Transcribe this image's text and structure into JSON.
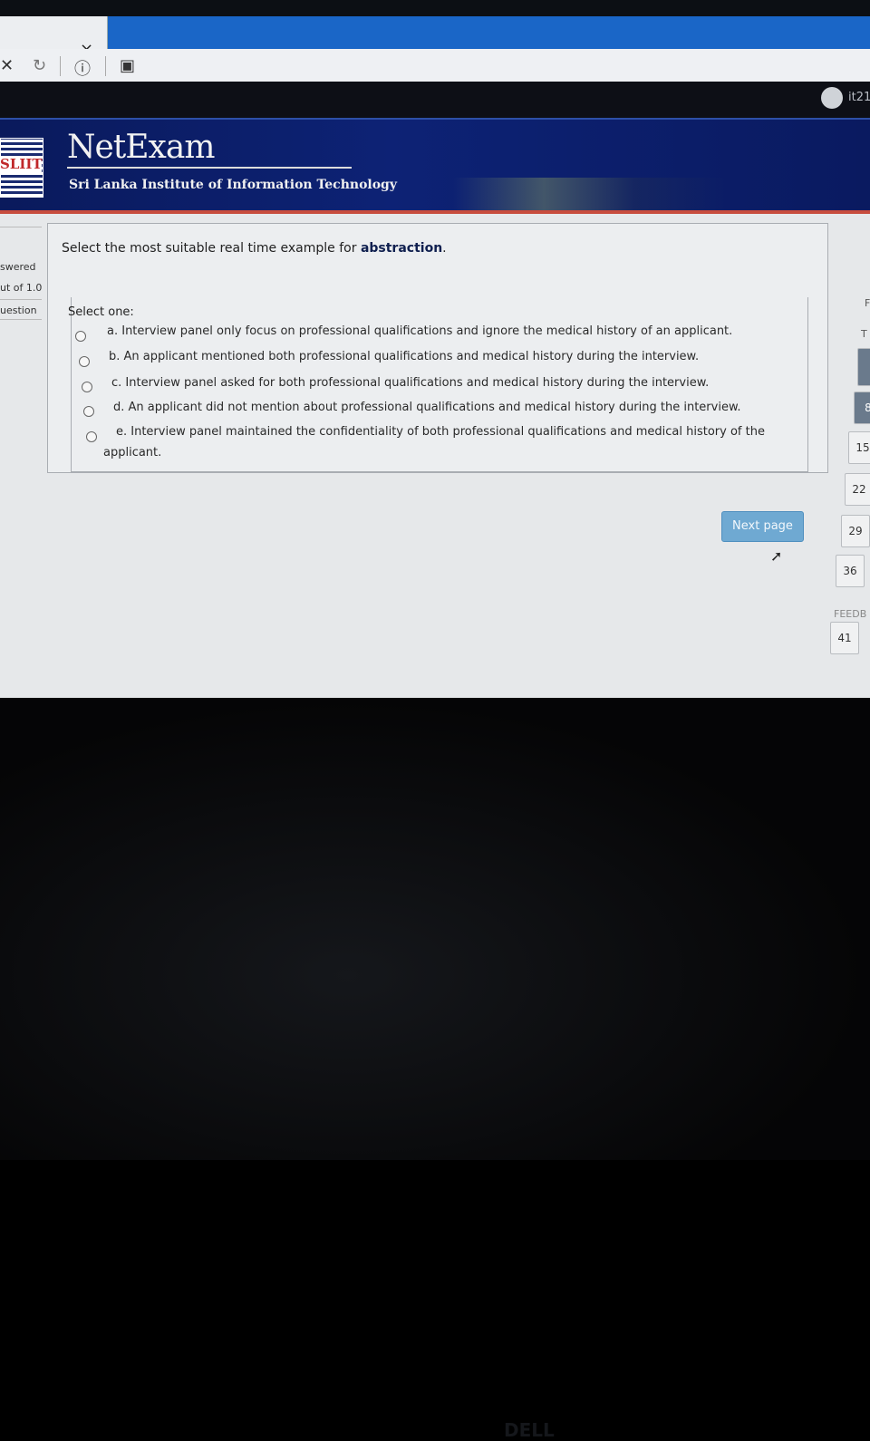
{
  "browser": {
    "tab_close_glyph": "×",
    "nav_icons": [
      "close-icon",
      "reload-icon",
      "info-icon",
      "page-icon"
    ],
    "user_name": "it21"
  },
  "header": {
    "logo_text": "SLIIT",
    "title": "NetExam",
    "subtitle": "Sri Lanka Institute of Information Technology"
  },
  "left_info": {
    "answered": "swered",
    "marks": "ut of 1.0",
    "question": "uestion"
  },
  "question": {
    "prefix": "Select the most suitable real time example for ",
    "highlight": "abstraction",
    "suffix": ".",
    "select_label": "Select one:",
    "options": [
      {
        "text": "a. Interview panel only focus on professional qualifications and ignore the medical history of an applicant."
      },
      {
        "text": "b. An applicant mentioned both professional qualifications and medical history during the interview."
      },
      {
        "text": "c. Interview panel asked for both professional qualifications and medical history during the interview."
      },
      {
        "text": "d. An applicant did not mention about professional qualifications and medical history during the interview."
      },
      {
        "text": "e. Interview panel maintained the confidentiality of both professional qualifications and medical history of the",
        "text2": "applicant."
      }
    ]
  },
  "buttons": {
    "next_page": "Next page"
  },
  "quiz_nav": {
    "tiles": [
      "8",
      "15",
      "22",
      "29",
      "36",
      "41"
    ],
    "feedback_label": "FEEDB",
    "letters": [
      "F",
      "T"
    ]
  },
  "device": {
    "brand": "DELL"
  }
}
